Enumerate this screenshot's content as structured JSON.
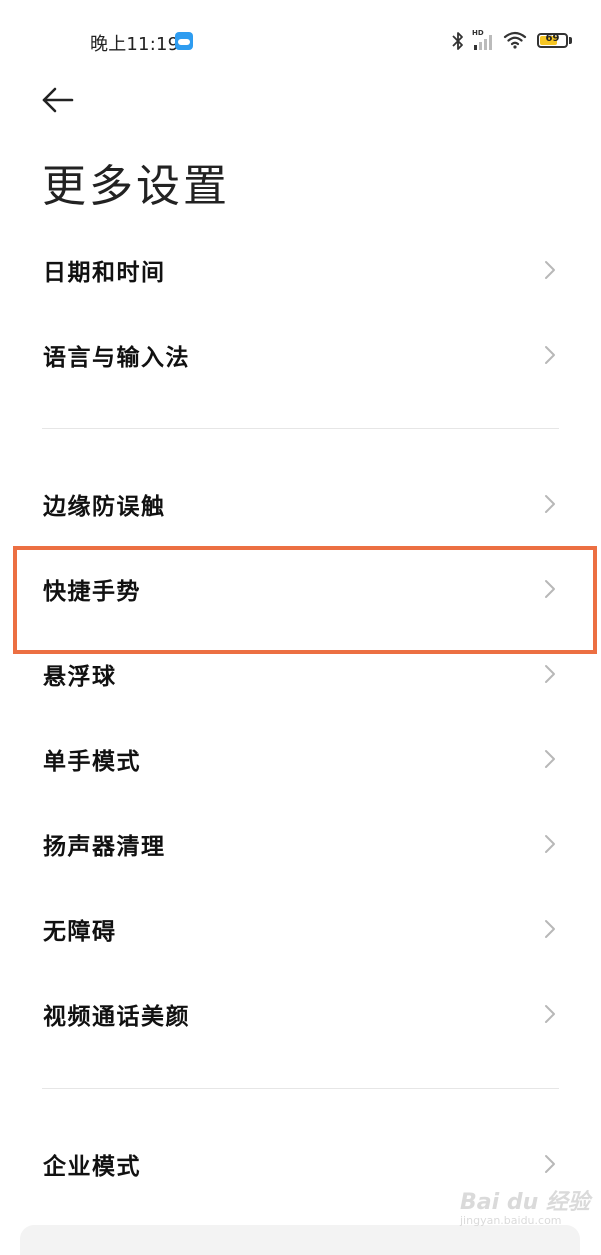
{
  "status_bar": {
    "time": "晚上11:19",
    "network_badge": "HD",
    "battery_level": "69",
    "battery_fraction": 0.69,
    "icons": [
      "cloud-icon",
      "bluetooth-icon",
      "signal-icon",
      "wifi-icon",
      "battery-icon"
    ]
  },
  "header": {
    "back_icon": "arrow-left-icon",
    "title": "更多设置"
  },
  "settings": {
    "group1": [
      {
        "label": "日期和时间"
      },
      {
        "label": "语言与输入法"
      }
    ],
    "group2": [
      {
        "label": "边缘防误触"
      },
      {
        "label": "快捷手势"
      },
      {
        "label": "悬浮球"
      },
      {
        "label": "单手模式"
      },
      {
        "label": "扬声器清理"
      },
      {
        "label": "无障碍"
      },
      {
        "label": "视频通话美颜"
      }
    ],
    "group3": [
      {
        "label": "企业模式"
      }
    ]
  },
  "highlight": {
    "target": "快捷手势",
    "color": "#ec6f42"
  },
  "watermark": {
    "brand": "Bai du 经验",
    "sub": "jingyan.baidu.com"
  },
  "colors": {
    "accent_cloud": "#2e9cf0",
    "battery": "#f6c623",
    "text": "#111111",
    "chevron": "#b8b8b8"
  }
}
